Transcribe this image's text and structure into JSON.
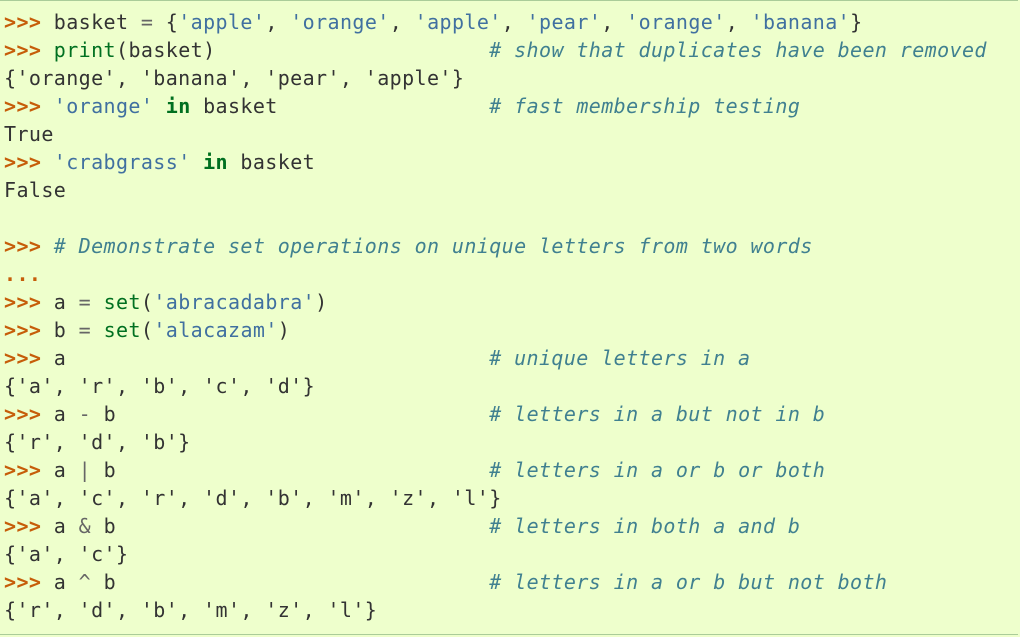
{
  "prompt": ">>>",
  "continuation": "...",
  "lines": [
    {
      "type": "input",
      "parts": [
        {
          "k": "n",
          "t": "basket "
        },
        {
          "k": "o",
          "t": "="
        },
        {
          "k": "n",
          "t": " {"
        },
        {
          "k": "s",
          "t": "'apple'"
        },
        {
          "k": "n",
          "t": ", "
        },
        {
          "k": "s",
          "t": "'orange'"
        },
        {
          "k": "n",
          "t": ", "
        },
        {
          "k": "s",
          "t": "'apple'"
        },
        {
          "k": "n",
          "t": ", "
        },
        {
          "k": "s",
          "t": "'pear'"
        },
        {
          "k": "n",
          "t": ", "
        },
        {
          "k": "s",
          "t": "'orange'"
        },
        {
          "k": "n",
          "t": ", "
        },
        {
          "k": "s",
          "t": "'banana'"
        },
        {
          "k": "n",
          "t": "}"
        }
      ]
    },
    {
      "type": "input",
      "parts": [
        {
          "k": "b",
          "t": "print"
        },
        {
          "k": "n",
          "t": "(basket)                      "
        },
        {
          "k": "c",
          "t": "# show that duplicates have been removed"
        }
      ]
    },
    {
      "type": "output",
      "text": "{'orange', 'banana', 'pear', 'apple'}"
    },
    {
      "type": "input",
      "parts": [
        {
          "k": "s",
          "t": "'orange'"
        },
        {
          "k": "n",
          "t": " "
        },
        {
          "k": "k",
          "t": "in"
        },
        {
          "k": "n",
          "t": " basket                 "
        },
        {
          "k": "c",
          "t": "# fast membership testing"
        }
      ]
    },
    {
      "type": "output",
      "text": "True"
    },
    {
      "type": "input",
      "parts": [
        {
          "k": "s",
          "t": "'crabgrass'"
        },
        {
          "k": "n",
          "t": " "
        },
        {
          "k": "k",
          "t": "in"
        },
        {
          "k": "n",
          "t": " basket"
        }
      ]
    },
    {
      "type": "output",
      "text": "False"
    },
    {
      "type": "blank"
    },
    {
      "type": "input",
      "parts": [
        {
          "k": "c",
          "t": "# Demonstrate set operations on unique letters from two words"
        }
      ]
    },
    {
      "type": "continuation"
    },
    {
      "type": "input",
      "parts": [
        {
          "k": "n",
          "t": "a "
        },
        {
          "k": "o",
          "t": "="
        },
        {
          "k": "n",
          "t": " "
        },
        {
          "k": "b",
          "t": "set"
        },
        {
          "k": "n",
          "t": "("
        },
        {
          "k": "s",
          "t": "'abracadabra'"
        },
        {
          "k": "n",
          "t": ")"
        }
      ]
    },
    {
      "type": "input",
      "parts": [
        {
          "k": "n",
          "t": "b "
        },
        {
          "k": "o",
          "t": "="
        },
        {
          "k": "n",
          "t": " "
        },
        {
          "k": "b",
          "t": "set"
        },
        {
          "k": "n",
          "t": "("
        },
        {
          "k": "s",
          "t": "'alacazam'"
        },
        {
          "k": "n",
          "t": ")"
        }
      ]
    },
    {
      "type": "input",
      "parts": [
        {
          "k": "n",
          "t": "a                                  "
        },
        {
          "k": "c",
          "t": "# unique letters in a"
        }
      ]
    },
    {
      "type": "output",
      "text": "{'a', 'r', 'b', 'c', 'd'}"
    },
    {
      "type": "input",
      "parts": [
        {
          "k": "n",
          "t": "a "
        },
        {
          "k": "o",
          "t": "-"
        },
        {
          "k": "n",
          "t": " b                              "
        },
        {
          "k": "c",
          "t": "# letters in a but not in b"
        }
      ]
    },
    {
      "type": "output",
      "text": "{'r', 'd', 'b'}"
    },
    {
      "type": "input",
      "parts": [
        {
          "k": "n",
          "t": "a "
        },
        {
          "k": "o",
          "t": "|"
        },
        {
          "k": "n",
          "t": " b                              "
        },
        {
          "k": "c",
          "t": "# letters in a or b or both"
        }
      ]
    },
    {
      "type": "output",
      "text": "{'a', 'c', 'r', 'd', 'b', 'm', 'z', 'l'}"
    },
    {
      "type": "input",
      "parts": [
        {
          "k": "n",
          "t": "a "
        },
        {
          "k": "o",
          "t": "&"
        },
        {
          "k": "n",
          "t": " b                              "
        },
        {
          "k": "c",
          "t": "# letters in both a and b"
        }
      ]
    },
    {
      "type": "output",
      "text": "{'a', 'c'}"
    },
    {
      "type": "input",
      "parts": [
        {
          "k": "n",
          "t": "a "
        },
        {
          "k": "o",
          "t": "^"
        },
        {
          "k": "n",
          "t": " b                              "
        },
        {
          "k": "c",
          "t": "# letters in a or b but not both"
        }
      ]
    },
    {
      "type": "output",
      "text": "{'r', 'd', 'b', 'm', 'z', 'l'}"
    }
  ]
}
